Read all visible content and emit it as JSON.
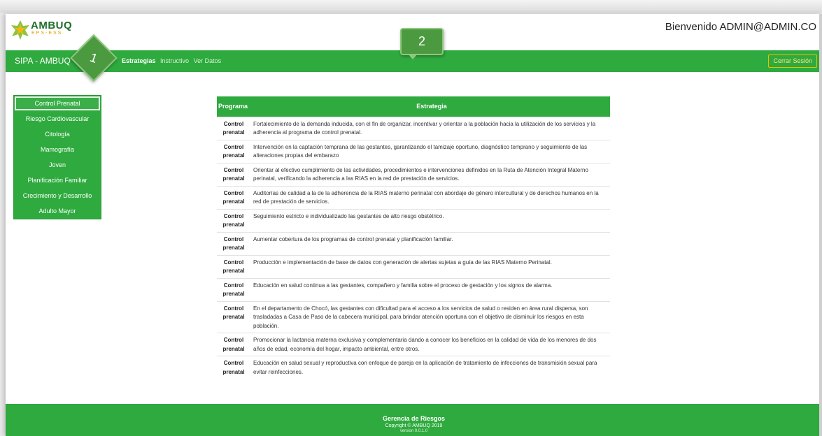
{
  "header": {
    "logo_text": "AMBUQ",
    "logo_sub": "EPS-ESS",
    "welcome": "Bienvenido ADMIN@ADMIN.CO"
  },
  "navbar": {
    "brand": "SIPA - AMBUQ",
    "links": [
      "Estrategias",
      "Instructivo",
      "Ver Datos"
    ],
    "logout": "Cerrar Sesión"
  },
  "callouts": {
    "one": "1",
    "two": "2"
  },
  "sidebar": {
    "items": [
      "Control Prenatal",
      "Riesgo Cardiovascular",
      "Citología",
      "Mamografía",
      "Joven",
      "Planificación Familiar",
      "Crecimiento y Desarrollo",
      "Adulto Mayor"
    ]
  },
  "table": {
    "headers": [
      "Programa",
      "Estrategia"
    ],
    "program": "Control prenatal",
    "rows": [
      "Fortalecimiento de la demanda inducida, con el fin de organizar, incentivar y orientar a la población hacia la utilización de los servicios y la adherencia al programa de control prenatal.",
      "Intervención en la captación temprana de las gestantes, garantizando el tamizaje oportuno, diagnóstico temprano y seguimiento de las alteraciones propias del embarazo",
      "Orientar al efectivo cumplimiento de las actividades, procedimientos e intervenciones definidos en la Ruta de Atención Integral Materno perinatal, verificando la adherencia a las RIAS en la red de prestación de servicios.",
      "Auditorías de calidad a la de la adherencia de la RIAS materno perinatal con abordaje de género intercultural y de derechos humanos en la red de prestación de servicios.",
      "Seguimiento estricto e individualizado las gestantes de alto riesgo obstétrico.",
      "Aumentar cobertura de los programas de control prenatal y planificación familiar.",
      "Producción e implementación de base de datos con generación de alertas sujetas a guía de las RIAS Materno Perinatal.",
      "Educación en salud continua a las gestantes, compañero y familia sobre el proceso de gestación y los signos de alarma.",
      "En el departamento de Chocó, las gestantes con dificultad para el acceso a los servicios de salud o residen en área rural dispersa, son trasladadas a Casa de Paso de la cabecera municipal, para brindar atención oportuna con el objetivo de disminuir los riesgos en esta población.",
      "Promocionar la lactancia materna exclusiva y complementaria dando a conocer los beneficios en la calidad de vida de los menores de dos años de edad, economía del hogar, impacto ambiental, entre otros.",
      "Educación en salud sexual y reproductiva con enfoque de pareja en la aplicación de tratamiento de infecciones de transmisión sexual para evitar reinfecciones."
    ]
  },
  "footer": {
    "title": "Gerencia de Riesgos",
    "copyright": "Copyright © AMBUQ 2019",
    "version": "version 0.0.1.0"
  },
  "colors": {
    "accent": "#2eaa3e",
    "logout_border": "#e7c200"
  }
}
